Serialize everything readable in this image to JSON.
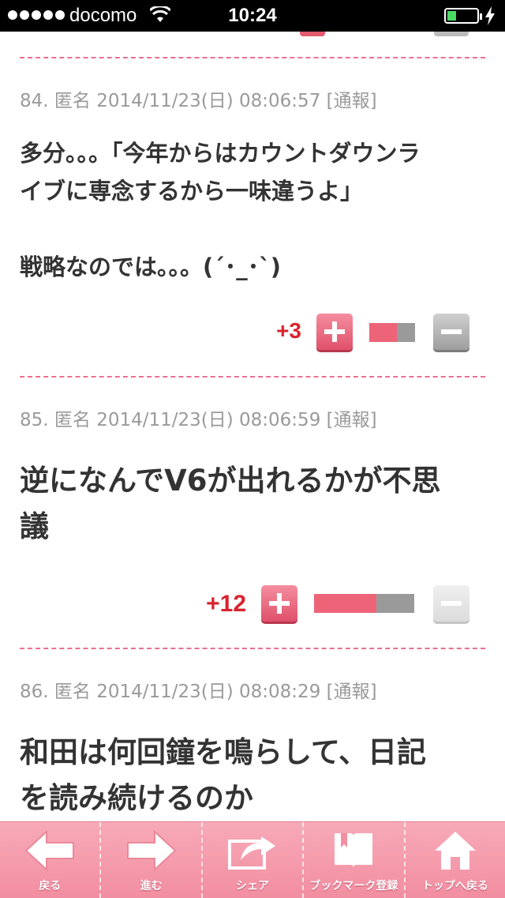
{
  "status_bar": {
    "carrier": "docomo",
    "time": "10:24",
    "battery_level": 0.3
  },
  "comments": [
    {
      "number": "84.",
      "author": "匿名",
      "datetime": "2014/11/23(日) 08:06:57",
      "report_label": "通報",
      "lines": [
        "多分。。。「今年からはカウントダウンラ",
        "イブに専念するから一味違うよ」",
        "",
        "戦略なのでは。。。(´･_･`)"
      ],
      "score": "+3",
      "positive_ratio": 0.6
    },
    {
      "number": "85.",
      "author": "匿名",
      "datetime": "2014/11/23(日) 08:06:59",
      "report_label": "通報",
      "lines": [
        "逆になんでV6が出れるかが不思",
        "議"
      ],
      "score": "+12",
      "positive_ratio": 0.62
    },
    {
      "number": "86.",
      "author": "匿名",
      "datetime": "2014/11/23(日) 08:08:29",
      "report_label": "通報",
      "lines": [
        "和田は何回鐘を鳴らして、日記",
        "を読み続けるのか"
      ]
    }
  ],
  "toolbar": {
    "back": "戻る",
    "forward": "進む",
    "share": "シェア",
    "bookmark": "ブックマーク登録",
    "top": "トップへ戻る"
  },
  "colors": {
    "accent": "#ec6f91",
    "score": "#d9232e",
    "toolbar": "#f28ea1"
  }
}
